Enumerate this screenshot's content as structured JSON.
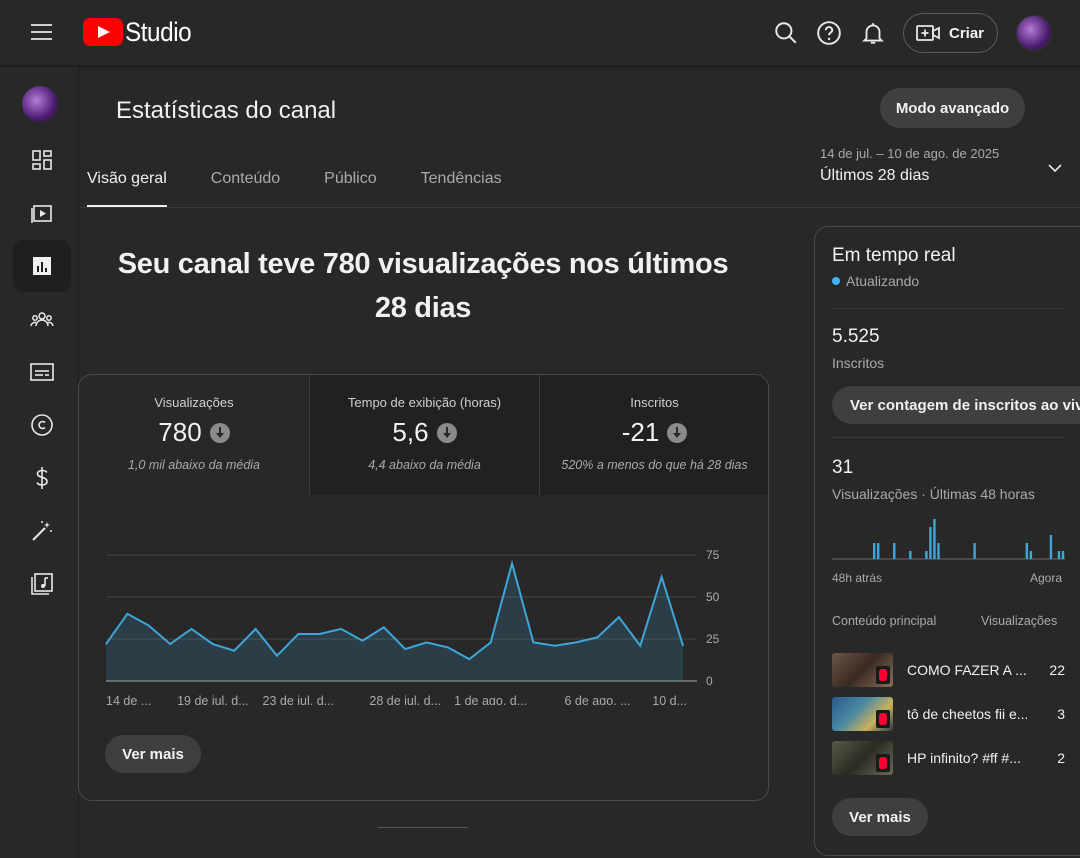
{
  "header": {
    "logo_text": "Studio",
    "create_label": "Criar",
    "icons": [
      "menu-icon",
      "search-icon",
      "help-icon",
      "notifications-icon",
      "create-video-icon"
    ]
  },
  "sidebar": {
    "items": [
      {
        "icon": "dashboard-icon"
      },
      {
        "icon": "content-icon"
      },
      {
        "icon": "analytics-icon",
        "active": true
      },
      {
        "icon": "community-icon"
      },
      {
        "icon": "subtitles-icon"
      },
      {
        "icon": "copyright-icon"
      },
      {
        "icon": "monetization-icon"
      },
      {
        "icon": "customization-icon"
      },
      {
        "icon": "audio-library-icon"
      }
    ]
  },
  "page": {
    "title": "Estatísticas do canal",
    "advanced_mode_label": "Modo avançado",
    "date_range_detail": "14 de jul. – 10 de ago. de 2025",
    "date_range_label": "Últimos 28 dias"
  },
  "tabs": [
    {
      "label": "Visão geral",
      "active": true
    },
    {
      "label": "Conteúdo"
    },
    {
      "label": "Público"
    },
    {
      "label": "Tendências"
    }
  ],
  "overview": {
    "headline_line1": "Seu canal teve 780 visualizações nos últimos",
    "headline_line2": "28 dias",
    "metrics": [
      {
        "label": "Visualizações",
        "value": "780",
        "note": "1,0 mil abaixo da média"
      },
      {
        "label": "Tempo de exibição (horas)",
        "value": "5,6",
        "note": "4,4 abaixo da média"
      },
      {
        "label": "Inscritos",
        "value": "-21",
        "note": "520% a menos do que há 28 dias"
      }
    ],
    "see_more_label": "Ver mais"
  },
  "chart_data": {
    "type": "area",
    "x_tick_labels": [
      "14 de ...",
      "19 de jul. d...",
      "23 de jul. d...",
      "28 de jul. d...",
      "1 de ago. d...",
      "6 de ago. ...",
      "10 d..."
    ],
    "y_ticks": [
      0,
      25,
      50,
      75
    ],
    "ylim": [
      0,
      75
    ],
    "values": [
      22,
      40,
      33,
      22,
      31,
      22,
      18,
      31,
      15,
      28,
      28,
      31,
      24,
      32,
      19,
      23,
      20,
      13,
      23,
      70,
      23,
      21,
      23,
      26,
      38,
      21,
      62,
      21
    ],
    "color": "#3ea6d9"
  },
  "realtime": {
    "title": "Em tempo real",
    "status": "Atualizando",
    "subscribers_value": "5.525",
    "subscribers_label": "Inscritos",
    "live_count_button": "Ver contagem de inscritos ao vivo",
    "views_value": "31",
    "views_label": "Visualizações · Últimas 48 horas",
    "axis_left": "48h atrás",
    "axis_right": "Agora",
    "bars": [
      0,
      0,
      0,
      0,
      0,
      0,
      0,
      0,
      0,
      0,
      4,
      4,
      0,
      0,
      0,
      4,
      0,
      0,
      0,
      2,
      0,
      0,
      0,
      2,
      8,
      10,
      4,
      0,
      0,
      0,
      0,
      0,
      0,
      0,
      0,
      4,
      0,
      0,
      0,
      0,
      0,
      0,
      0,
      0,
      0,
      0,
      0,
      0,
      4,
      2,
      0,
      0,
      0,
      0,
      6,
      0,
      2,
      2
    ],
    "top_content_label": "Conteúdo principal",
    "views_column_label": "Visualizações",
    "top_content": [
      {
        "title": "COMO FAZER A ...",
        "views": "22"
      },
      {
        "title": "tô de cheetos fii e...",
        "views": "3"
      },
      {
        "title": "HP infinito? #ff #...",
        "views": "2"
      }
    ],
    "see_more_label": "Ver mais"
  }
}
